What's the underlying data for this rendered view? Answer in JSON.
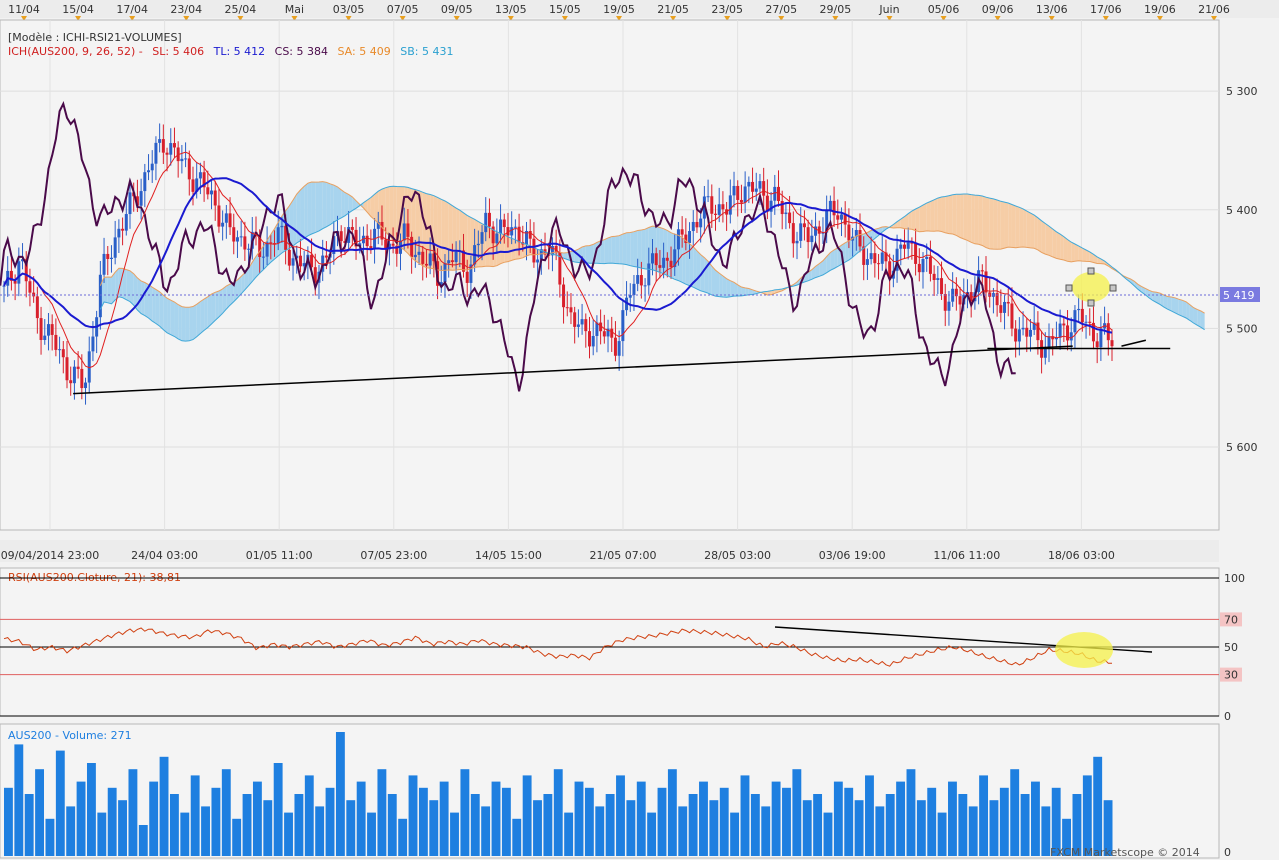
{
  "top_axis": {
    "labels": [
      "11/04",
      "15/04",
      "17/04",
      "23/04",
      "25/04",
      "Mai",
      "03/05",
      "07/05",
      "09/05",
      "13/05",
      "15/05",
      "19/05",
      "21/05",
      "23/05",
      "27/05",
      "29/05",
      "Juin",
      "05/06",
      "09/06",
      "13/06",
      "17/06",
      "19/06",
      "21/06"
    ]
  },
  "main_chart": {
    "model_label": "[Modèle : ICHI-RSI21-VOLUMES]",
    "indicator": {
      "name": "ICH(AUS200, 9, 26, 52) -",
      "sl": "SL: 5 406",
      "tl": "TL: 5 412",
      "cs": "CS: 5 384",
      "sa": "SA: 5 409",
      "sb": "SB: 5 431"
    },
    "y_ticks": [
      "5 600",
      "5 500",
      "5 400",
      "5 300"
    ],
    "price_marker": "5 419",
    "x_ticks": [
      "09/04/2014 23:00",
      "24/04 03:00",
      "01/05 11:00",
      "07/05 23:00",
      "14/05 15:00",
      "21/05 07:00",
      "28/05 03:00",
      "03/06 19:00",
      "11/06 11:00",
      "18/06 03:00"
    ],
    "colors": {
      "candle_up": "#2a5fc8",
      "candle_down": "#d8202c",
      "sl": "#e02020",
      "tl": "#1a1ad0",
      "cs": "#4a0a4a",
      "kumo_up": "#a8d4ee",
      "kumo_down": "#f6cda6",
      "trend": "#000000"
    }
  },
  "rsi_panel": {
    "label": "RSI(AUS200.Cloture, 21): 38,81",
    "levels": [
      "100",
      "70",
      "50",
      "30",
      "0"
    ],
    "color": "#d04010"
  },
  "volume_panel": {
    "label": "AUS200 - Volume: 271",
    "y_tick": "0",
    "color": "#1e7fe0"
  },
  "footer": {
    "credit": "FXCM Marketscope © 2014"
  },
  "chart_data": [
    {
      "type": "candlestick",
      "series": [
        {
          "name": "ICH(AUS200, 9, 26, 52) - SL"
        },
        {
          "name": "TL"
        },
        {
          "name": "CS"
        },
        {
          "name": "SA"
        },
        {
          "name": "SB"
        }
      ],
      "y_ticks": [
        5300,
        5400,
        5500,
        5600
      ],
      "ylim": [
        5230,
        5660
      ],
      "last_price": 5419,
      "indicator_values": {
        "SL": 5406,
        "TL": 5412,
        "CS": 5384,
        "SA": 5409,
        "SB": 5431
      },
      "close_profile": [
        5430,
        5460,
        5410,
        5390,
        5365,
        5350,
        5440,
        5480,
        5505,
        5535,
        5560,
        5540,
        5525,
        5510,
        5480,
        5475,
        5465,
        5480,
        5460,
        5450,
        5455,
        5485,
        5470,
        5480,
        5470,
        5475,
        5460,
        5445,
        5460,
        5450,
        5490,
        5480,
        5485,
        5460,
        5470,
        5420,
        5395,
        5400,
        5385,
        5430,
        5450,
        5455,
        5470,
        5490,
        5505,
        5500,
        5520,
        5515,
        5510,
        5485,
        5475,
        5490,
        5500,
        5470,
        5460,
        5450,
        5470,
        5460,
        5440,
        5420,
        5430,
        5440,
        5420,
        5400,
        5395,
        5385,
        5400,
        5410,
        5395,
        5390
      ],
      "trendlines": [
        {
          "from": [
            0.06,
            5345
          ],
          "to": [
            0.88,
            5385
          ]
        },
        {
          "from": [
            0.81,
            5383
          ],
          "to": [
            0.96,
            5383
          ]
        },
        {
          "from": [
            0.92,
            5385
          ],
          "to": [
            0.94,
            5390
          ]
        }
      ],
      "x_ticks": [
        "09/04/2014 23:00",
        "24/04 03:00",
        "01/05 11:00",
        "07/05 23:00",
        "14/05 15:00",
        "21/05 07:00",
        "28/05 03:00",
        "03/06 19:00",
        "11/06 11:00",
        "18/06 03:00"
      ]
    },
    {
      "type": "line",
      "name": "RSI(AUS200.Cloture, 21)",
      "last_value": 38.81,
      "levels": [
        0,
        30,
        50,
        70,
        100
      ],
      "ylim": [
        0,
        100
      ],
      "profile": [
        56,
        54,
        48,
        50,
        47,
        51,
        55,
        59,
        62,
        63,
        60,
        58,
        57,
        62,
        60,
        56,
        49,
        52,
        50,
        52,
        54,
        50,
        52,
        55,
        51,
        53,
        57,
        52,
        54,
        52,
        55,
        52,
        51,
        50,
        45,
        43,
        44,
        42,
        50,
        55,
        57,
        58,
        60,
        62,
        61,
        60,
        58,
        56,
        50,
        53,
        50,
        45,
        42,
        40,
        41,
        39,
        37,
        42,
        45,
        48,
        50,
        47,
        43,
        40,
        37,
        42,
        48,
        47,
        45,
        40,
        38.81
      ]
    },
    {
      "type": "bar",
      "name": "AUS200 - Volume",
      "last_value": 271,
      "profile": [
        0.55,
        0.9,
        0.5,
        0.7,
        0.3,
        0.85,
        0.4,
        0.6,
        0.75,
        0.35,
        0.55,
        0.45,
        0.7,
        0.25,
        0.6,
        0.8,
        0.5,
        0.35,
        0.65,
        0.4,
        0.55,
        0.7,
        0.3,
        0.5,
        0.6,
        0.45,
        0.75,
        0.35,
        0.5,
        0.65,
        0.4,
        0.55,
        1.0,
        0.45,
        0.6,
        0.35,
        0.7,
        0.5,
        0.3,
        0.65,
        0.55,
        0.45,
        0.6,
        0.35,
        0.7,
        0.5,
        0.4,
        0.6,
        0.55,
        0.3,
        0.65,
        0.45,
        0.5,
        0.7,
        0.35,
        0.6,
        0.55,
        0.4,
        0.5,
        0.65,
        0.45,
        0.6,
        0.35,
        0.55,
        0.7,
        0.4,
        0.5,
        0.6,
        0.45,
        0.55,
        0.35,
        0.65,
        0.5,
        0.4,
        0.6,
        0.55,
        0.7,
        0.45,
        0.5,
        0.35,
        0.6,
        0.55,
        0.45,
        0.65,
        0.4,
        0.5,
        0.6,
        0.7,
        0.45,
        0.55,
        0.35,
        0.6,
        0.5,
        0.4,
        0.65,
        0.45,
        0.55,
        0.7,
        0.5,
        0.6,
        0.4,
        0.55,
        0.3,
        0.5,
        0.65,
        0.8,
        0.45
      ]
    }
  ]
}
